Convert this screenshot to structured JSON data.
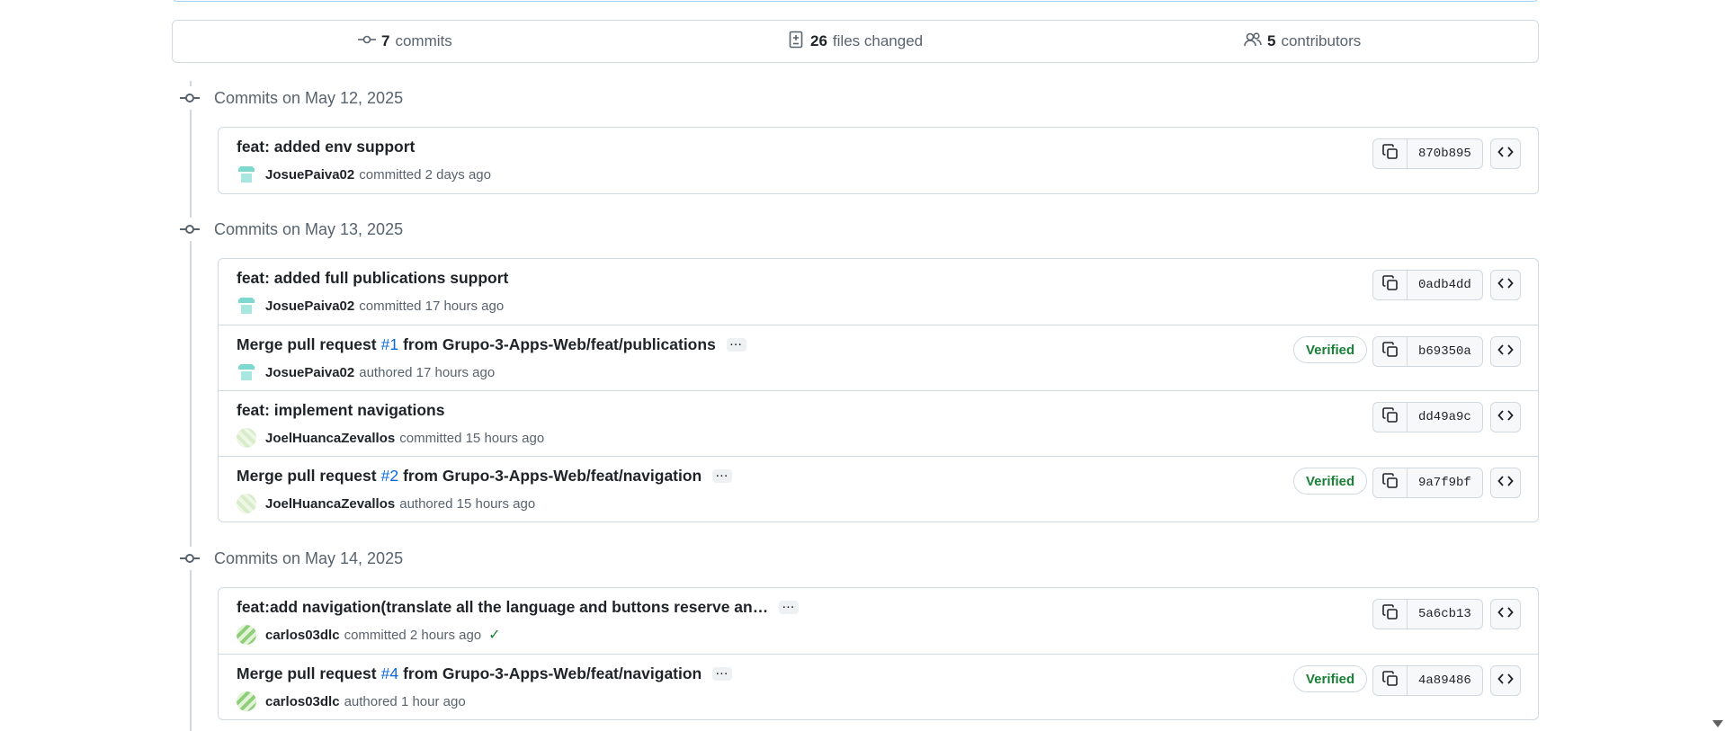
{
  "summary": {
    "commits_count": "7",
    "commits_label": "commits",
    "files_count": "26",
    "files_label": "files changed",
    "contributors_count": "5",
    "contributors_label": "contributors"
  },
  "groups": [
    {
      "header": "Commits on May 12, 2025",
      "commits": [
        {
          "title": "feat: added env support",
          "author": "JosuePaiva02",
          "action": "committed 2 days ago",
          "sha": "870b895"
        }
      ]
    },
    {
      "header": "Commits on May 13, 2025",
      "commits": [
        {
          "title": "feat: added full publications support",
          "author": "JosuePaiva02",
          "action": "committed 17 hours ago",
          "sha": "0adb4dd"
        },
        {
          "title_prefix": "Merge pull request",
          "pr": "#1",
          "title_suffix": "from Grupo-3-Apps-Web/feat/publications",
          "more": "···",
          "author": "JosuePaiva02",
          "action": "authored 17 hours ago",
          "verified": "Verified",
          "sha": "b69350a"
        },
        {
          "title": "feat: implement navigations",
          "author": "JoelHuancaZevallos",
          "action": "committed 15 hours ago",
          "sha": "dd49a9c"
        },
        {
          "title_prefix": "Merge pull request",
          "pr": "#2",
          "title_suffix": "from Grupo-3-Apps-Web/feat/navigation",
          "more": "···",
          "author": "JoelHuancaZevallos",
          "action": "authored 15 hours ago",
          "verified": "Verified",
          "sha": "9a7f9bf"
        }
      ]
    },
    {
      "header": "Commits on May 14, 2025",
      "commits": [
        {
          "title": "feat:add navigation(translate all the language and buttons reserve an…",
          "more": "···",
          "author": "carlos03dlc",
          "action": "committed 2 hours ago",
          "check": "✓",
          "sha": "5a6cb13"
        },
        {
          "title_prefix": "Merge pull request",
          "pr": "#4",
          "title_suffix": "from Grupo-3-Apps-Web/feat/navigation",
          "more": "···",
          "author": "carlos03dlc",
          "action": "authored 1 hour ago",
          "verified": "Verified",
          "sha": "4a89486"
        }
      ]
    }
  ],
  "icons": {
    "commit": "git-commit-icon",
    "files": "file-diff-icon",
    "contributors": "people-icon",
    "copy": "copy-icon",
    "browse": "code-icon"
  },
  "colors": {
    "verified": "#1a7f37",
    "link": "#0969da",
    "border": "#d1d9e0"
  }
}
